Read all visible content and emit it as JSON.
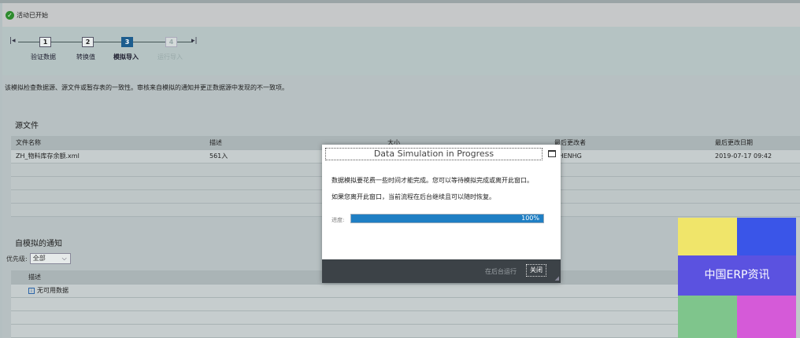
{
  "status": {
    "text": "活动已开始"
  },
  "wizard": {
    "steps": [
      {
        "num": "1",
        "label": "验证数据",
        "state": "done"
      },
      {
        "num": "2",
        "label": "转换值",
        "state": "done"
      },
      {
        "num": "3",
        "label": "模拟导入",
        "state": "active"
      },
      {
        "num": "4",
        "label": "运行导入",
        "state": "disabled"
      }
    ]
  },
  "description": "该模拟检查数据源、源文件或暂存表的一致性。审核来自模拟的通知并更正数据源中发现的不一致项。",
  "source_files": {
    "title": "源文件",
    "columns": [
      "文件名称",
      "描述",
      "大小",
      "最后更改者",
      "最后更改日期"
    ],
    "rows": [
      [
        "ZH_物料库存余额.xml",
        "561入",
        "",
        "CHENHG",
        "2019-07-17 09:42"
      ]
    ]
  },
  "notifications": {
    "title": "自模拟的通知",
    "priority_label": "优先级:",
    "priority_value": "全部",
    "columns": [
      "描述"
    ],
    "empty_text": "无可用数据"
  },
  "dialog": {
    "title": "Data Simulation in Progress",
    "message1": "数据模拟要花费一些时间才能完成。您可以等待模拟完成或离开此窗口。",
    "message2": "如果您离开此窗口，当前流程在后台继续且可以随时恢复。",
    "progress_label": "进度:",
    "progress_value": 100,
    "progress_text": "100%",
    "background_button": "在后台运行",
    "close_button": "关闭"
  },
  "watermark": {
    "text": "中国ERP资讯",
    "colors": [
      "#f0e56a",
      "#3a55e8",
      "#7fc58c",
      "#d55ad8",
      "#5b52e0"
    ]
  }
}
